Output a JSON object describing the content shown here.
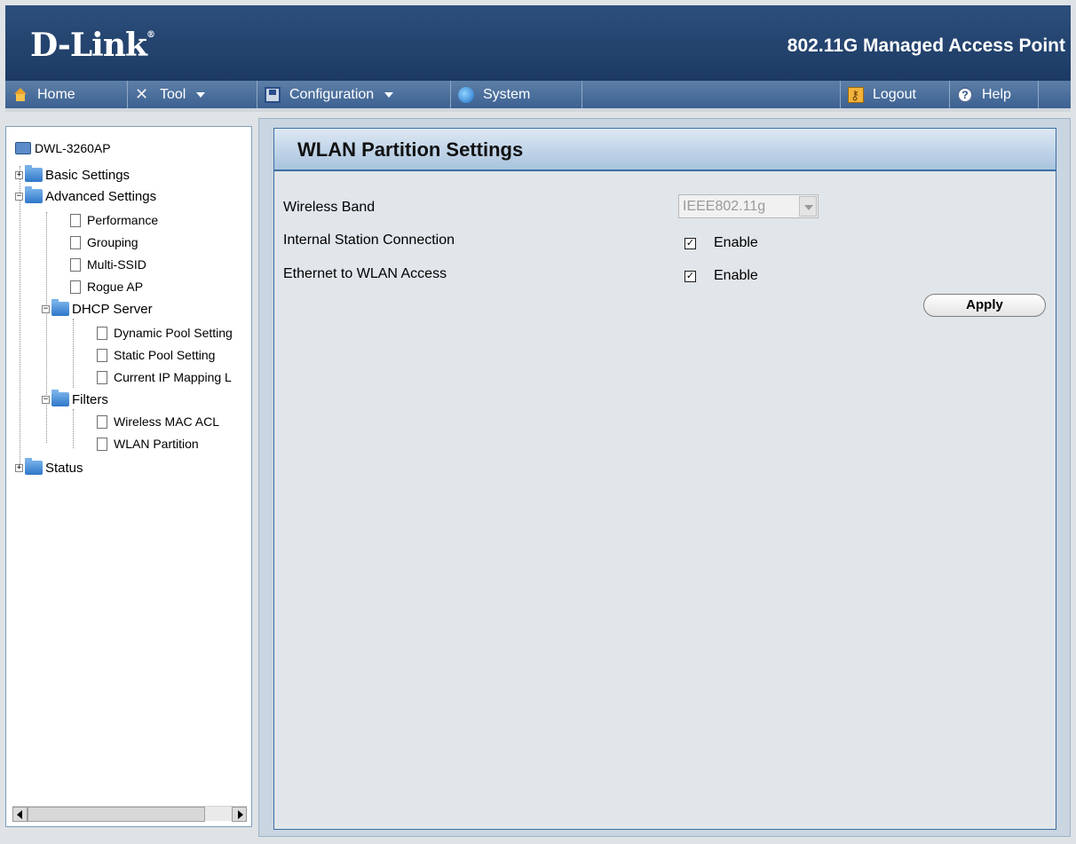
{
  "header": {
    "logo": "D-Link",
    "product": "802.11G Managed Access Point"
  },
  "nav": {
    "home": "Home",
    "tool": "Tool",
    "configuration": "Configuration",
    "system": "System",
    "logout": "Logout",
    "help": "Help"
  },
  "tree": {
    "root": "DWL-3260AP",
    "basic_settings": "Basic Settings",
    "advanced_settings": "Advanced Settings",
    "performance": "Performance",
    "grouping": "Grouping",
    "multi_ssid": "Multi-SSID",
    "rogue_ap": "Rogue AP",
    "dhcp_server": "DHCP Server",
    "dynamic_pool": "Dynamic Pool Setting",
    "static_pool": "Static Pool Setting",
    "current_ip": "Current IP Mapping L",
    "filters": "Filters",
    "wireless_mac_acl": "Wireless MAC ACL",
    "wlan_partition": "WLAN Partition",
    "status": "Status"
  },
  "panel": {
    "title": "WLAN Partition Settings",
    "wireless_band_label": "Wireless Band",
    "wireless_band_value": "IEEE802.11g",
    "internal_station_label": "Internal Station Connection",
    "internal_station_enable": "Enable",
    "ethernet_wlan_label": "Ethernet to WLAN Access",
    "ethernet_wlan_enable": "Enable",
    "apply": "Apply"
  }
}
